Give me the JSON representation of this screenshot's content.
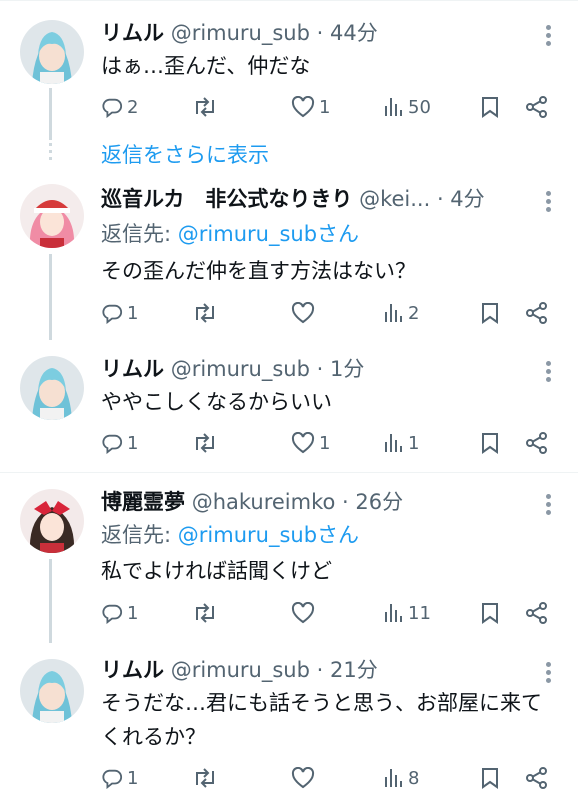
{
  "tweets": [
    {
      "name": "リムル",
      "handle": "@rimuru_sub",
      "time": "· 44分",
      "text": "はぁ…歪んだ、仲だな",
      "reply_to_prefix": "",
      "reply_to_handle": "",
      "counts": {
        "reply": "2",
        "retweet": "",
        "like": "1",
        "views": "50"
      }
    },
    {
      "name": "巡音ルカ　非公式なりきり",
      "handle": "@kei...",
      "time": "· 4分",
      "text": "その歪んだ仲を直す方法はない？",
      "reply_to_prefix": "返信先: ",
      "reply_to_handle": "@rimuru_subさん",
      "counts": {
        "reply": "1",
        "retweet": "",
        "like": "",
        "views": "2"
      }
    },
    {
      "name": "リムル",
      "handle": "@rimuru_sub",
      "time": "· 1分",
      "text": "ややこしくなるからいい",
      "reply_to_prefix": "",
      "reply_to_handle": "",
      "counts": {
        "reply": "1",
        "retweet": "",
        "like": "1",
        "views": "1"
      }
    },
    {
      "name": "博麗霊夢",
      "handle": "@hakureimko",
      "time": "· 26分",
      "text": "私でよければ話聞くけど",
      "reply_to_prefix": "返信先: ",
      "reply_to_handle": "@rimuru_subさん",
      "counts": {
        "reply": "1",
        "retweet": "",
        "like": "",
        "views": "11"
      }
    },
    {
      "name": "リムル",
      "handle": "@rimuru_sub",
      "time": "· 21分",
      "text": "そうだな…君にも話そうと思う、お部屋に来てくれるか？",
      "reply_to_prefix": "",
      "reply_to_handle": "",
      "counts": {
        "reply": "1",
        "retweet": "",
        "like": "",
        "views": "8"
      }
    }
  ],
  "show_more_replies": "返信をさらに表示",
  "colors": {
    "accent": "#1d9bf0",
    "muted": "#536471",
    "text": "#0f1419",
    "line": "#cfd9de"
  },
  "icons": [
    "reply-icon",
    "retweet-icon",
    "like-icon",
    "views-icon",
    "bookmark-icon",
    "share-icon",
    "more-icon"
  ]
}
